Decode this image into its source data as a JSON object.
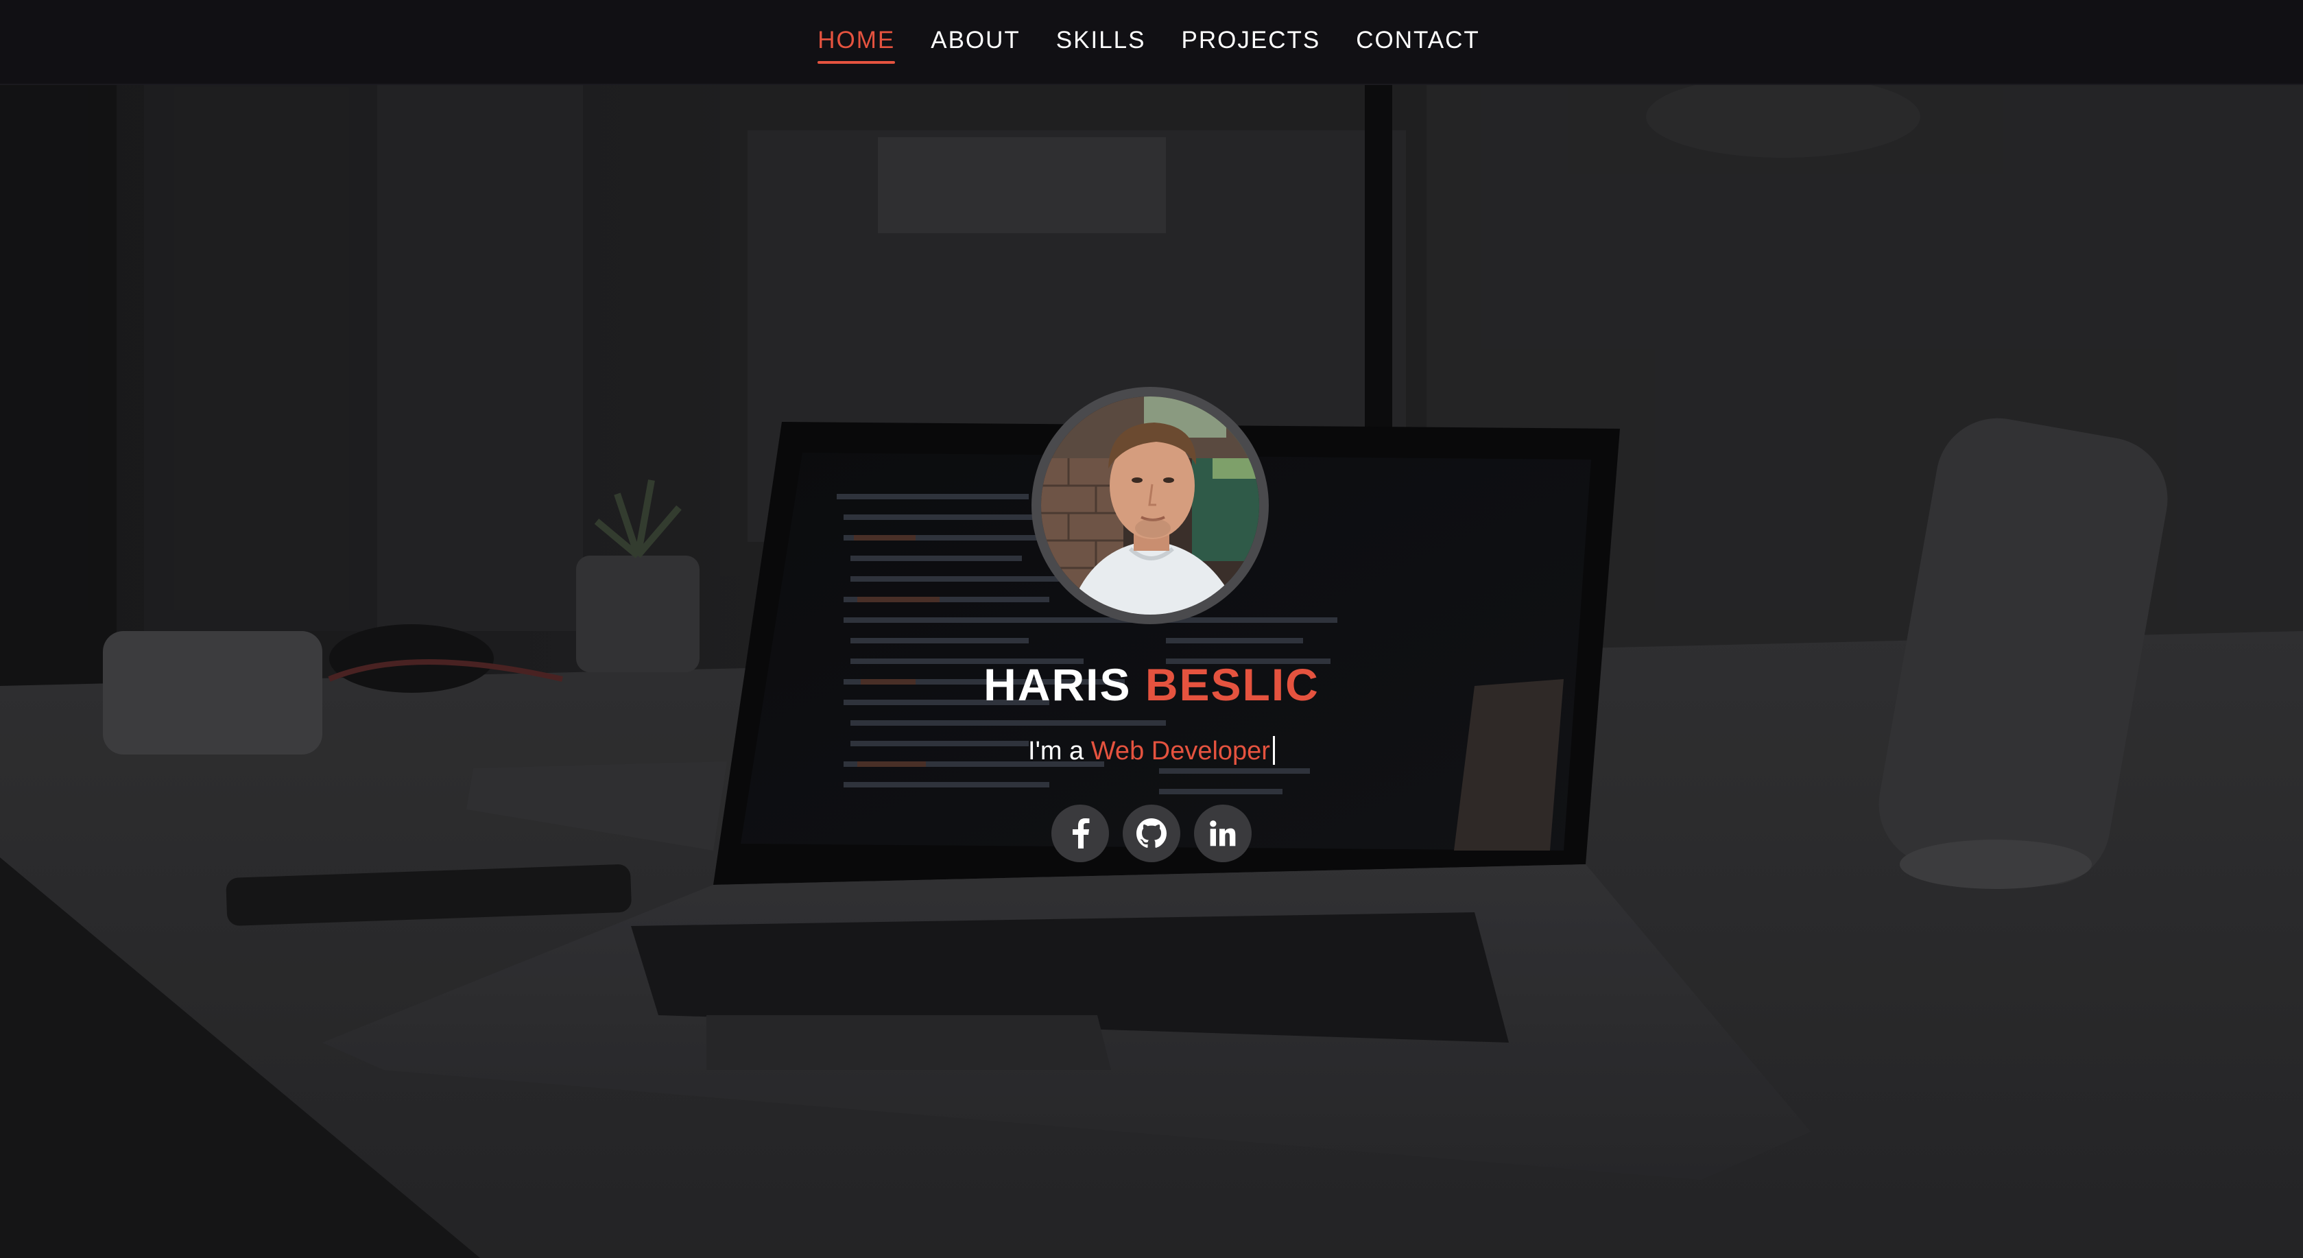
{
  "nav": {
    "items": [
      {
        "label": "HOME",
        "active": true
      },
      {
        "label": "ABOUT",
        "active": false
      },
      {
        "label": "SKILLS",
        "active": false
      },
      {
        "label": "PROJECTS",
        "active": false
      },
      {
        "label": "CONTACT",
        "active": false
      }
    ]
  },
  "hero": {
    "first_name": "HARIS",
    "last_name": "BESLIC",
    "tagline_prefix": "I'm a ",
    "tagline_role": "Web Developer"
  },
  "socials": [
    {
      "icon": "facebook-icon",
      "label": "f"
    },
    {
      "icon": "github-icon"
    },
    {
      "icon": "linkedin-icon",
      "label": "in"
    }
  ],
  "colors": {
    "accent": "#e5533f",
    "navbar": "#111014",
    "text": "#ffffff"
  }
}
